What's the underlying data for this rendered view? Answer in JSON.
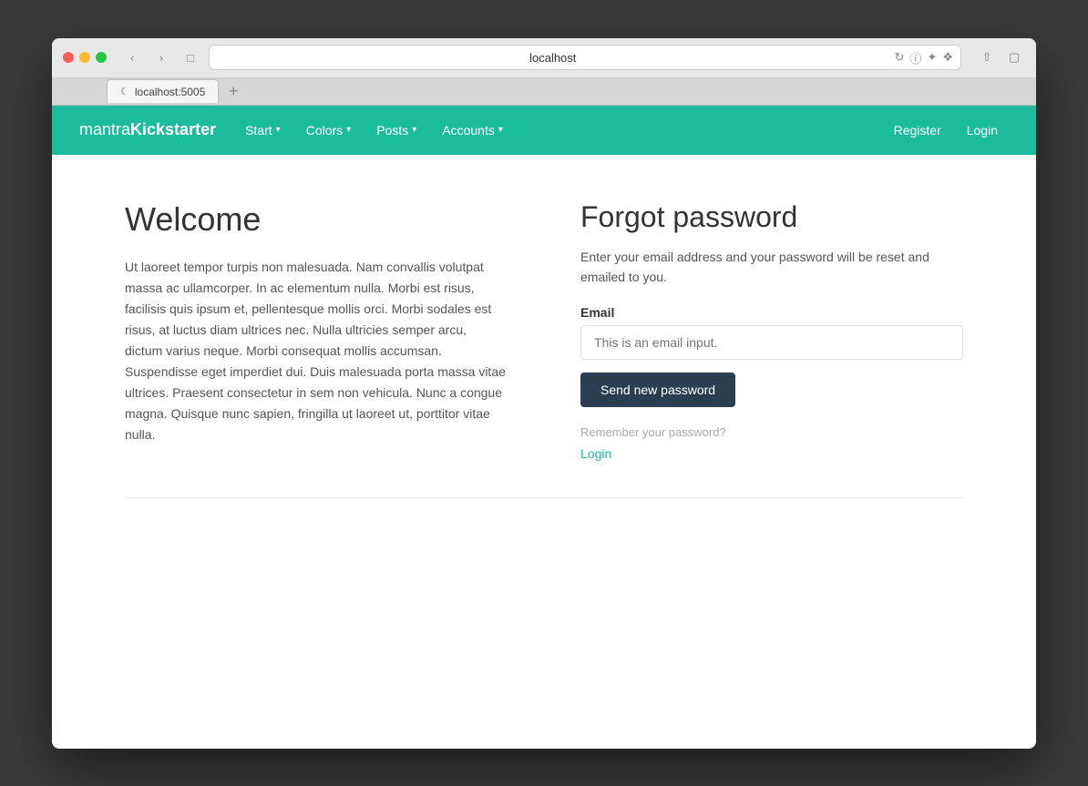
{
  "browser": {
    "url": "localhost",
    "tab_url": "localhost:5005",
    "tab_label": "localhost:5005"
  },
  "navbar": {
    "brand": "mantraKickstarter",
    "brand_part1": "mantra",
    "brand_part2": "Kickstarter",
    "nav_items": [
      {
        "label": "Start",
        "caret": true
      },
      {
        "label": "Colors",
        "caret": true
      },
      {
        "label": "Posts",
        "caret": true
      },
      {
        "label": "Accounts",
        "caret": true
      }
    ],
    "register_label": "Register",
    "login_label": "Login"
  },
  "left": {
    "title": "Welcome",
    "body": "Ut laoreet tempor turpis non malesuada. Nam convallis volutpat massa ac ullamcorper. In ac elementum nulla. Morbi est risus, facilisis quis ipsum et, pellentesque mollis orci. Morbi sodales est risus, at luctus diam ultrices nec. Nulla ultricies semper arcu, dictum varius neque. Morbi consequat mollis accumsan. Suspendisse eget imperdiet dui. Duis malesuada porta massa vitae ultrices. Praesent consectetur in sem non vehicula. Nunc a congue magna. Quisque nunc sapien, fringilla ut laoreet ut, porttitor vitae nulla."
  },
  "forgot_password": {
    "title": "Forgot password",
    "description": "Enter your email address and your password will be reset and emailed to you.",
    "email_label": "Email",
    "email_placeholder": "This is an email input.",
    "button_label": "Send new password",
    "remember_text": "Remember your password?",
    "login_link": "Login"
  }
}
